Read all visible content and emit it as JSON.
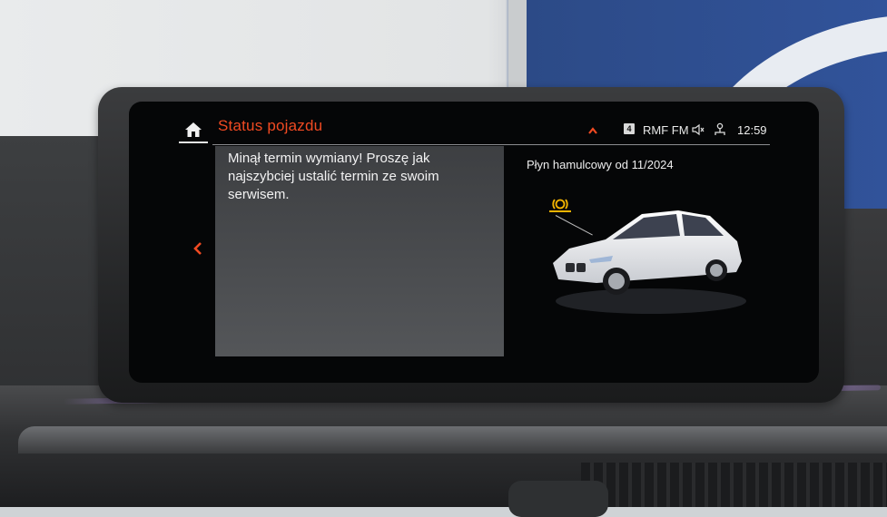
{
  "header": {
    "title": "Status pojazdu",
    "radio_badge": "4",
    "radio_station": "RMF FM",
    "clock": "12:59"
  },
  "icons": {
    "home": "home-icon",
    "expand": "chevron-up-icon",
    "mute": "speaker-mute-icon",
    "phone": "phone-icon",
    "back": "chevron-left-icon",
    "warning": "brake-warning-icon"
  },
  "message": {
    "text": "Minął termin wymiany! Proszę jak najszybciej ustalić termin ze swoim serwisem."
  },
  "detail": {
    "label": "Płyn hamulcowy od 11/2024"
  },
  "colors": {
    "accent": "#f04a22",
    "warning": "#f5b400",
    "panel": "#46484b"
  }
}
